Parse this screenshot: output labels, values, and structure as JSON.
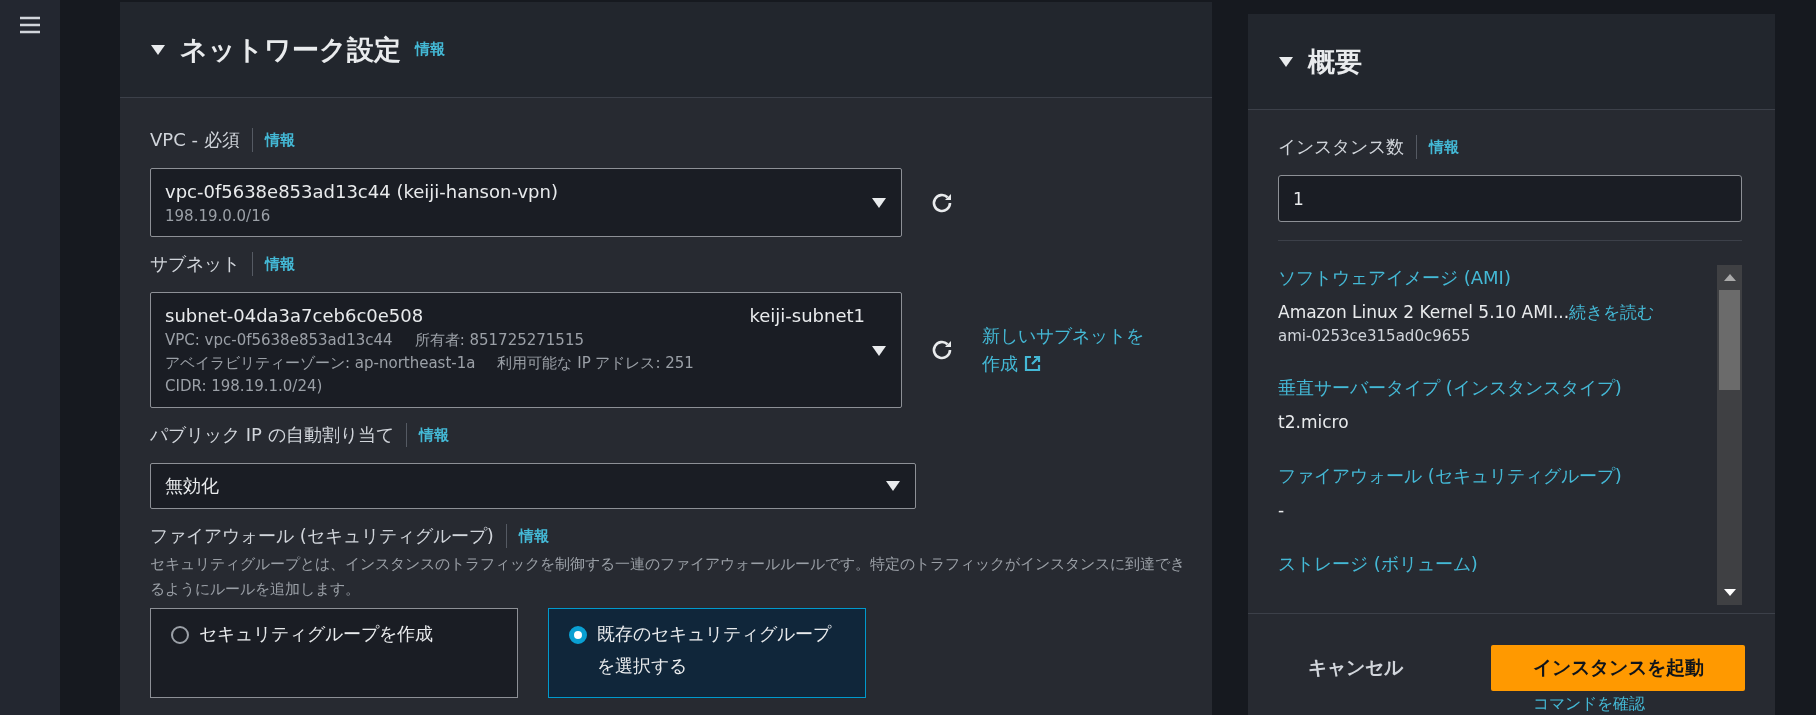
{
  "network_panel": {
    "title": "ネットワーク設定",
    "info": "情報",
    "expanded": true,
    "fields": [
      {
        "kind": "select",
        "label": "VPC - 必須",
        "info": "情報",
        "value": "vpc-0f5638e853ad13c44 (keiji-hanson-vpn)",
        "detail": "198.19.0.0/16",
        "refresh": true
      },
      {
        "kind": "subnet",
        "label": "サブネット",
        "info": "情報",
        "value": "subnet-04da3a7ceb6c0e508",
        "tag": "keiji-subnet1",
        "details": [
          [
            "VPC: vpc-0f5638e853ad13c44",
            "所有者: 851725271515"
          ],
          [
            "アベイラビリティーゾーン: ap-northeast-1a",
            "利用可能な IP アドレス: 251"
          ],
          [
            "CIDR: 198.19.1.0/24)"
          ]
        ],
        "refresh": true,
        "link": "新しいサブネットを作成"
      },
      {
        "kind": "select",
        "label": "パブリック IP の自動割り当て",
        "info": "情報",
        "value": "無効化",
        "refresh": false
      },
      {
        "kind": "radio",
        "label": "ファイアウォール (セキュリティグループ)",
        "info": "情報",
        "description": "セキュリティグループとは、インスタンスのトラフィックを制御する一連のファイアウォールルールです。特定のトラフィックがインスタンスに到達できるようにルールを追加します。",
        "options": [
          {
            "label": "セキュリティグループを作成",
            "selected": false
          },
          {
            "label": "既存のセキュリティグループを選択する",
            "selected": true
          }
        ]
      }
    ]
  },
  "summary": {
    "title": "概要",
    "expanded": true,
    "count_label": "インスタンス数",
    "info": "情報",
    "count_value": "1",
    "items": [
      {
        "label": "ソフトウェアイメージ (AMI)",
        "value": "Amazon Linux 2 Kernel 5.10 AMI...",
        "more": "続きを読む",
        "sub": "ami-0253ce315ad0c9655"
      },
      {
        "label": "垂直サーバータイプ (インスタンスタイプ)",
        "value": "t2.micro"
      },
      {
        "label": "ファイアウォール (セキュリティグループ)",
        "value": "-"
      },
      {
        "label": "ストレージ (ボリューム)"
      }
    ],
    "cancel": "キャンセル",
    "launch": "インスタンスを起動",
    "review": "コマンドを確認"
  }
}
